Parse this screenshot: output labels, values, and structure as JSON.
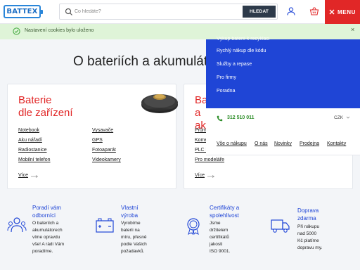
{
  "header": {
    "logo_text": "BATTEX",
    "search": {
      "placeholder": "Co hledáte?",
      "button_label": "HLEDAT"
    },
    "menu_label": "MENU"
  },
  "notice": {
    "text": "Nastavení cookies bylo uloženo",
    "close": "×"
  },
  "main": {
    "title": "O bateriích a akumulátorech"
  },
  "cards": [
    {
      "title_line1": "Baterie",
      "title_line2": "dle zařízení",
      "links_col1": [
        "Notebook",
        "Aku nářadí",
        "Radiostanice",
        "Mobilní telefon"
      ],
      "links_col2": [
        "Vysavače",
        "GPS",
        "Fotoaparát",
        "Videokamery"
      ],
      "more": "Více"
    },
    {
      "title_line1": "Baterie",
      "title_line2": "a akumulátory",
      "links": [
        "Průmyslové",
        "Komerční",
        "PLC baterie",
        "Pro modeláře"
      ],
      "more": "Více"
    }
  ],
  "dropdown": {
    "cut_item": "Výkup baterií k recyklaci",
    "items": [
      "Rychlý nákup dle kódu",
      "Služby a repase",
      "Pro firmy",
      "Poradna"
    ],
    "phone": "312 510 011",
    "currency": "CZK",
    "footer_links": [
      "Vše o nákupu",
      "O nás",
      "Novinky",
      "Prodejna",
      "Kontakty"
    ]
  },
  "features": [
    {
      "title": [
        "Poradí vám",
        "odborníci"
      ],
      "desc": [
        "O bateriích a",
        "akumulátorech",
        "víme opravdu",
        "vše! A rádi Vám",
        "poradíme."
      ]
    },
    {
      "title": [
        "Vlastní",
        "výroba"
      ],
      "desc": [
        "Vyrobíme",
        "baterii na",
        "míru, přesně",
        "podle Vašich",
        "požadavků."
      ]
    },
    {
      "title": [
        "Certifikáty a",
        "spolehlivost"
      ],
      "desc": [
        "Jsme",
        "držitelem",
        "certifikátů",
        "jakosti",
        "ISO 9001."
      ]
    },
    {
      "title": [
        "Doprava",
        "zdarma"
      ],
      "desc": [
        "Při nákupu",
        "nad 5000",
        "Kč platíme",
        "dopravu my."
      ]
    }
  ],
  "colors": {
    "brand_blue": "#1f45d6",
    "accent_red": "#e12727",
    "success_bg": "#dff4d8",
    "phone_green": "#2f8f2a"
  }
}
